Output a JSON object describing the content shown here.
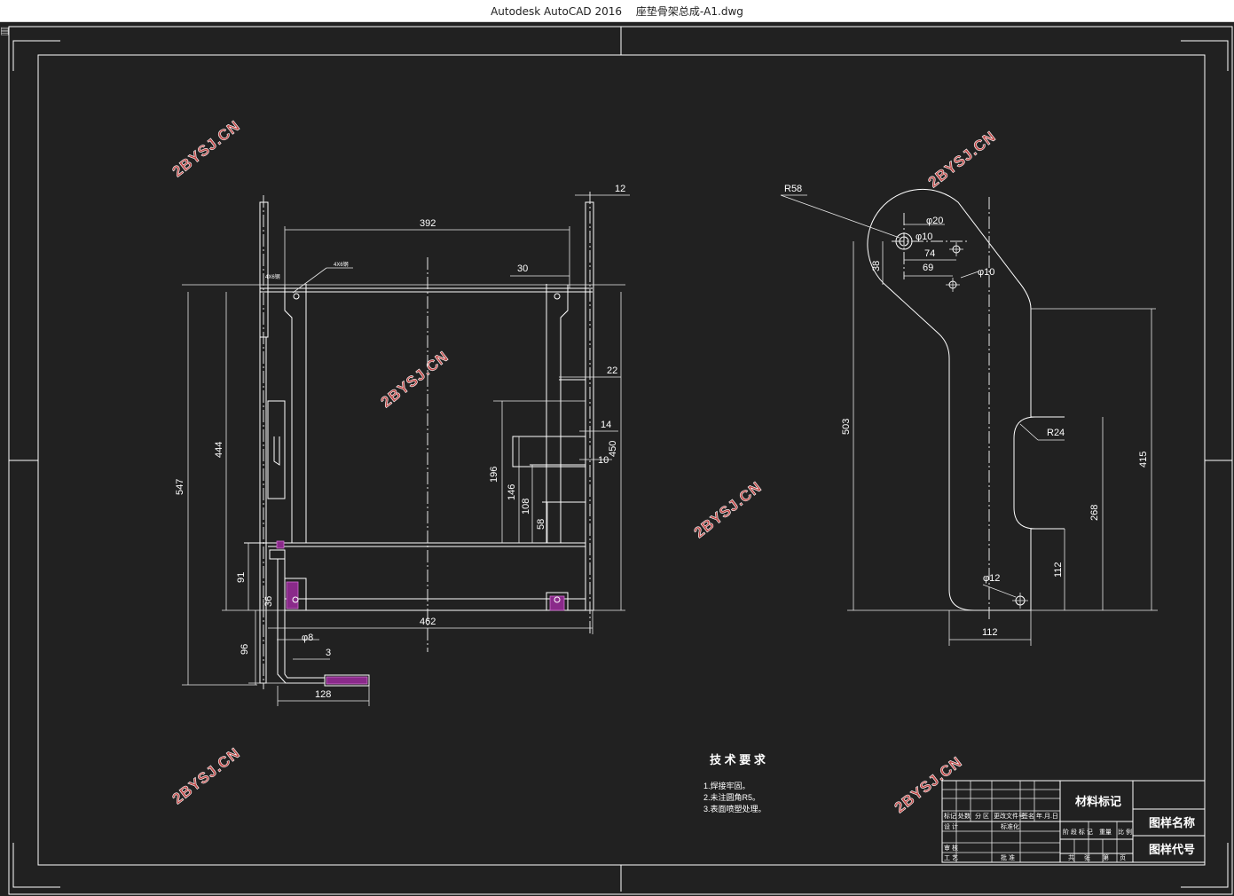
{
  "window": {
    "app_name": "Autodesk AutoCAD 2016",
    "file_name": "座垫骨架总成-A1.dwg",
    "icon": "app-icon"
  },
  "watermark": "2BYSJ.CN",
  "front_view": {
    "dims": {
      "d12": "12",
      "d392": "392",
      "d30": "30",
      "d22": "22",
      "d14": "14",
      "d10": "10",
      "d450": "450",
      "d547": "547",
      "d444": "444",
      "d196": "196",
      "d146": "146",
      "d108": "108",
      "d58": "58",
      "d91": "91",
      "d36": "36",
      "d96": "96",
      "d462": "462",
      "phi8": "φ8",
      "d3": "3",
      "d128": "128",
      "note_left": "4X6钢",
      "note_right": "4X6钢"
    }
  },
  "side_view": {
    "dims": {
      "r58": "R58",
      "phi20": "φ20",
      "phi10a": "φ10",
      "d74": "74",
      "d69": "69",
      "phi10b": "φ10",
      "d38": "38",
      "d503": "503",
      "d415": "415",
      "r24": "R24",
      "d268": "268",
      "d112v": "112",
      "phi12": "φ12",
      "d112h": "112"
    }
  },
  "tech_req": {
    "title": "技 术 要 求",
    "items": [
      "1.焊接牢固。",
      "2.未注圆角R5。",
      "3.表面喷塑处理。"
    ]
  },
  "title_block": {
    "material_mark": "材料标记",
    "drawing_name": "图样名称",
    "drawing_code": "图样代号",
    "cells": [
      "标记",
      "处数",
      "分 区",
      "更改文件号",
      "签名",
      "年.月.日",
      "设 计",
      "标准化",
      "阶 段 标 记",
      "重量",
      "比 例",
      "审 核",
      "工 艺",
      "批 准",
      "共",
      "张",
      "第",
      "页"
    ]
  }
}
